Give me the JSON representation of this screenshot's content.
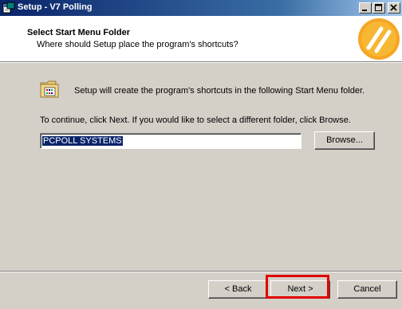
{
  "window": {
    "title": "Setup - V7 Polling",
    "app_icon": "setup-installer-icon",
    "controls": [
      "minimize-icon",
      "maximize-icon",
      "close-icon"
    ]
  },
  "header": {
    "title": "Select Start Menu Folder",
    "subtitle": "Where should Setup place the program's shortcuts?",
    "logo": "yellow-circle-logo"
  },
  "body": {
    "folder_icon": "start-menu-folder-icon",
    "intro_text": "Setup will create the program's shortcuts in the following Start Menu folder.",
    "continue_text": "To continue, click Next. If you would like to select a different folder, click Browse.",
    "folder_value": "PCPOLL SYSTEMS",
    "browse_label": "Browse..."
  },
  "footer": {
    "back_label": "< Back",
    "next_label": "Next >",
    "cancel_label": "Cancel",
    "highlight_color": "#e00000"
  }
}
